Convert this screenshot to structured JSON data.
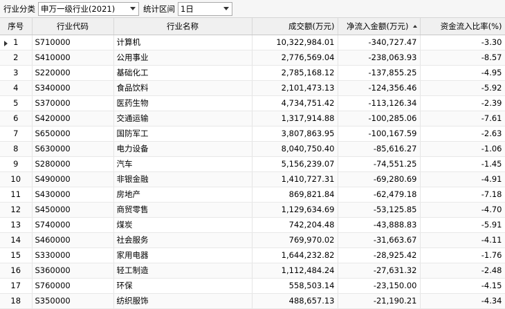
{
  "toolbar": {
    "category_label": "行业分类",
    "category_value": "申万一级行业(2021)",
    "period_label": "统计区间",
    "period_value": "1日"
  },
  "table": {
    "headers": [
      "序号",
      "行业代码",
      "行业名称",
      "成交额(万元)",
      "净流入金额(万元)",
      "资金流入比率(%)"
    ],
    "rows": [
      [
        "1",
        "S710000",
        "计算机",
        "10,322,984.01",
        "-340,727.47",
        "-3.30"
      ],
      [
        "2",
        "S410000",
        "公用事业",
        "2,776,569.04",
        "-238,063.93",
        "-8.57"
      ],
      [
        "3",
        "S220000",
        "基础化工",
        "2,785,168.12",
        "-137,855.25",
        "-4.95"
      ],
      [
        "4",
        "S340000",
        "食品饮料",
        "2,101,473.13",
        "-124,356.46",
        "-5.92"
      ],
      [
        "5",
        "S370000",
        "医药生物",
        "4,734,751.42",
        "-113,126.34",
        "-2.39"
      ],
      [
        "6",
        "S420000",
        "交通运输",
        "1,317,914.88",
        "-100,285.06",
        "-7.61"
      ],
      [
        "7",
        "S650000",
        "国防军工",
        "3,807,863.95",
        "-100,167.59",
        "-2.63"
      ],
      [
        "8",
        "S630000",
        "电力设备",
        "8,040,750.40",
        "-85,616.27",
        "-1.06"
      ],
      [
        "9",
        "S280000",
        "汽车",
        "5,156,239.07",
        "-74,551.25",
        "-1.45"
      ],
      [
        "10",
        "S490000",
        "非银金融",
        "1,410,727.31",
        "-69,280.69",
        "-4.91"
      ],
      [
        "11",
        "S430000",
        "房地产",
        "869,821.84",
        "-62,479.18",
        "-7.18"
      ],
      [
        "12",
        "S450000",
        "商贸零售",
        "1,129,634.69",
        "-53,125.85",
        "-4.70"
      ],
      [
        "13",
        "S740000",
        "煤炭",
        "742,204.48",
        "-43,888.83",
        "-5.91"
      ],
      [
        "14",
        "S460000",
        "社会服务",
        "769,970.02",
        "-31,663.67",
        "-4.11"
      ],
      [
        "15",
        "S330000",
        "家用电器",
        "1,644,232.82",
        "-28,925.42",
        "-1.76"
      ],
      [
        "16",
        "S360000",
        "轻工制造",
        "1,112,484.24",
        "-27,631.32",
        "-2.48"
      ],
      [
        "17",
        "S760000",
        "环保",
        "558,503.14",
        "-23,150.00",
        "-4.15"
      ],
      [
        "18",
        "S350000",
        "纺织服饰",
        "488,657.13",
        "-21,190.21",
        "-4.34"
      ]
    ]
  }
}
